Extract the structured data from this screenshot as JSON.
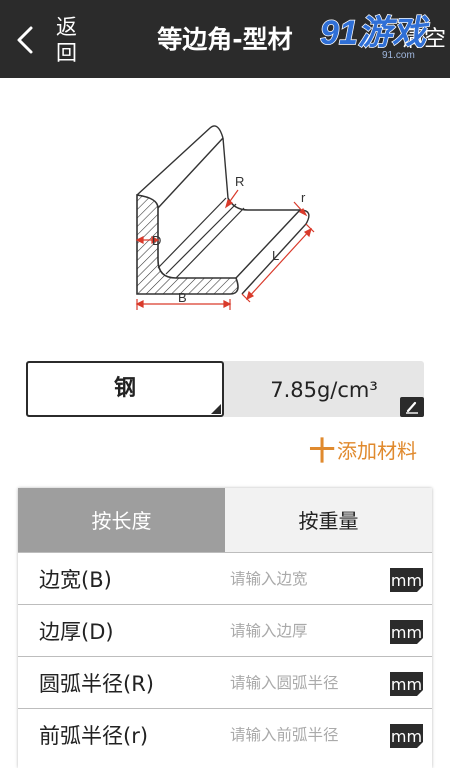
{
  "header": {
    "back_label": "返回",
    "title": "等边角-型材",
    "clear_label": "清空",
    "logo_text": "91游戏",
    "logo_sub": "91.com"
  },
  "diagram": {
    "labels": {
      "R": "R",
      "r": "r",
      "D": "D",
      "L": "L",
      "B": "B"
    },
    "line_color": "#d93a2b"
  },
  "material": {
    "name": "钢",
    "density": "7.85g/cm³"
  },
  "add_material": {
    "plus": "十",
    "label": "添加材料"
  },
  "tabs": [
    {
      "label": "按长度",
      "active": true
    },
    {
      "label": "按重量",
      "active": false
    }
  ],
  "fields": [
    {
      "label": "边宽(B)",
      "placeholder": "请输入边宽",
      "value": "",
      "unit": "mm"
    },
    {
      "label": "边厚(D)",
      "placeholder": "请输入边厚",
      "value": "",
      "unit": "mm"
    },
    {
      "label": "圆弧半径(R)",
      "placeholder": "请输入圆弧半径",
      "value": "",
      "unit": "mm"
    },
    {
      "label": "前弧半径(r)",
      "placeholder": "请输入前弧半径",
      "value": "",
      "unit": "mm"
    }
  ],
  "colors": {
    "header_bg": "#2b2b2b",
    "accent": "#e08a2e",
    "tab_active": "#9e9e9e",
    "logo_blue": "#2f6fd6"
  },
  "icons": {
    "back": "chevron-left-icon",
    "edit": "pencil-icon",
    "corner": "corner-triangle-icon",
    "plus": "plus-icon"
  }
}
